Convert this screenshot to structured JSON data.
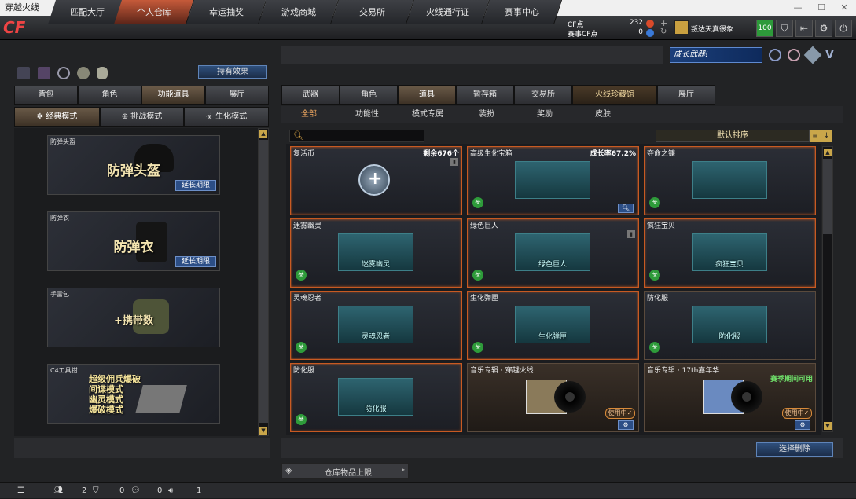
{
  "window": {
    "title": "穿越火线"
  },
  "nav": {
    "tabs": [
      "匹配大厅",
      "个人仓库",
      "幸运抽奖",
      "游戏商城",
      "交易所",
      "火线通行证",
      "赛事中心"
    ],
    "active": 1,
    "cf_label": "CF点",
    "cf_value": "232",
    "event_cf_label": "赛事CF点",
    "event_cf_value": "0",
    "username": "叛达天真很象",
    "level": "100"
  },
  "left": {
    "hold_effect": "持有效果",
    "tabs": [
      "背包",
      "角色",
      "功能道具",
      "展厅"
    ],
    "active_tab": 2,
    "modes": [
      "经典模式",
      "挑战模式",
      "生化模式"
    ],
    "cards": [
      {
        "title": "防弹头盔",
        "text": "防弹头盔",
        "extend": "延长期限"
      },
      {
        "title": "防弹衣",
        "text": "防弹衣",
        "extend": "延长期限"
      },
      {
        "title": "手雷包",
        "text": "+携带数"
      },
      {
        "title": "C4工具钳",
        "lines": [
          "超级佣兵爆破",
          "间谍模式",
          "幽灵模式",
          "爆破模式"
        ]
      }
    ]
  },
  "right": {
    "banner": "成长武器!",
    "tabs": [
      "武器",
      "角色",
      "道具",
      "暂存箱",
      "交易所",
      "火线珍藏馆",
      "展厅"
    ],
    "active_tab": 2,
    "subtabs": [
      "全部",
      "功能性",
      "模式专属",
      "装扮",
      "奖励",
      "皮肤"
    ],
    "active_subtab": 0,
    "sort": "默认排序",
    "items": [
      {
        "name": "复活币",
        "right": "剩余676个",
        "art": ""
      },
      {
        "name": "高级生化宝箱",
        "right": "成长率67.2%",
        "art": ""
      },
      {
        "name": "夺命之镰",
        "right": "",
        "art": ""
      },
      {
        "name": "迷雾幽灵",
        "right": "",
        "art": "迷雾幽灵"
      },
      {
        "name": "绿色巨人",
        "right": "",
        "art": "绿色巨人"
      },
      {
        "name": "疯狂宝贝",
        "right": "",
        "art": "疯狂宝贝"
      },
      {
        "name": "灵魂忍者",
        "right": "",
        "art": "灵魂忍者"
      },
      {
        "name": "生化弹匣",
        "right": "",
        "art": "生化弹匣"
      },
      {
        "name": "防化服",
        "right": "",
        "art": "防化服"
      },
      {
        "name": "防化服",
        "right": "",
        "art": "防化服"
      },
      {
        "name": "音乐专辑 · 穿越火线",
        "right": "",
        "art": "",
        "in_use": "使用中✓"
      },
      {
        "name": "音乐专辑 · 17th嘉年华",
        "right": "赛季期间可用",
        "art": "",
        "in_use": "使用中✓"
      }
    ],
    "delete_btn": "选择删除",
    "capacity": "仓库物品上限"
  },
  "status": {
    "a": "2",
    "b": "0",
    "c": "0",
    "d": "1"
  }
}
